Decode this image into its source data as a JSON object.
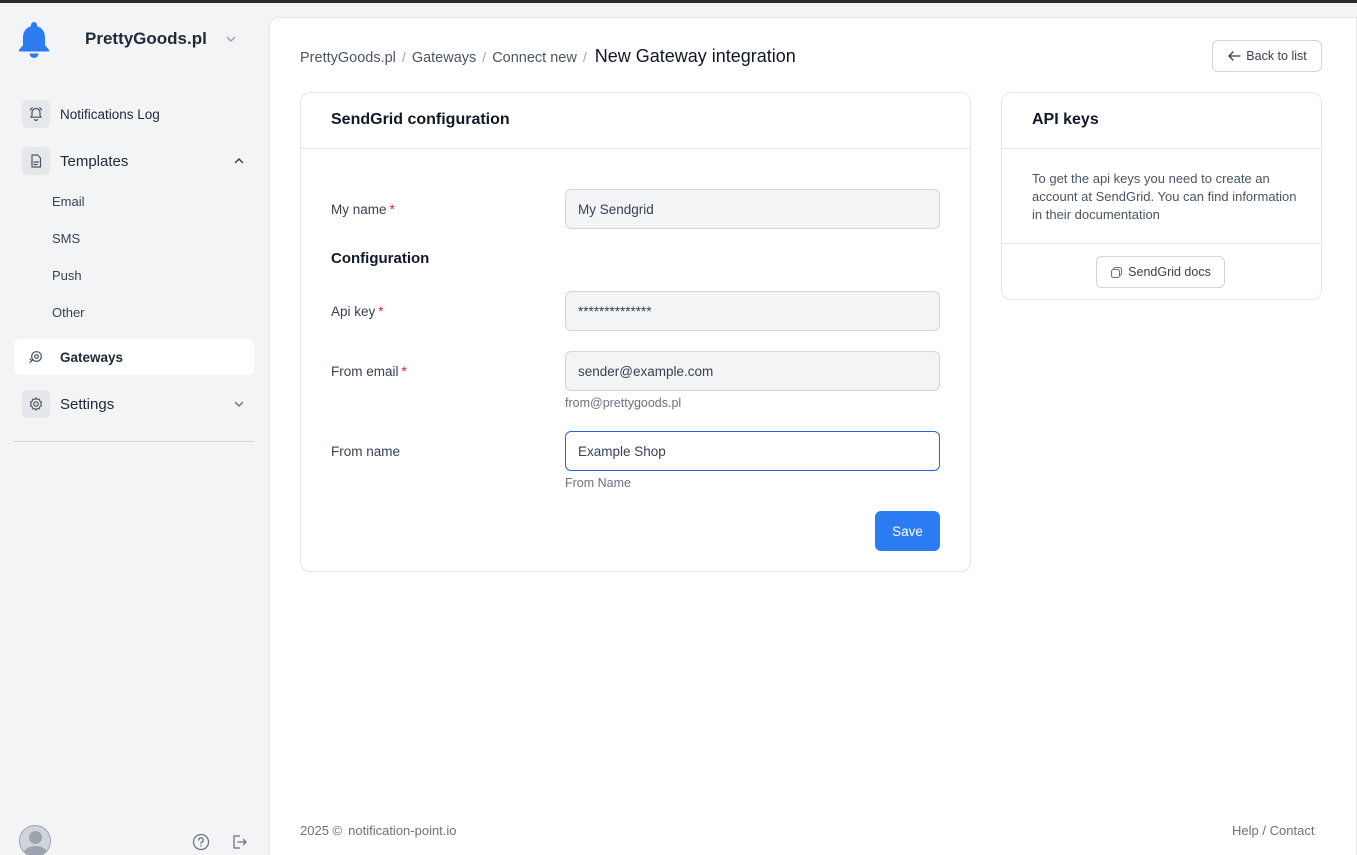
{
  "brand": {
    "name": "PrettyGoods.pl",
    "icon": "bell-icon",
    "accent": "#2b7bf3"
  },
  "sidebar": {
    "notifications_log": "Notifications Log",
    "templates": "Templates",
    "template_items": [
      "Email",
      "SMS",
      "Push",
      "Other"
    ],
    "gateways": "Gateways",
    "settings": "Settings"
  },
  "breadcrumb": {
    "items": [
      "PrettyGoods.pl",
      "Gateways",
      "Connect new"
    ],
    "separator": "/",
    "current": "New Gateway integration"
  },
  "back_button": "Back to list",
  "config_card": {
    "title": "SendGrid configuration",
    "fields": {
      "my_name": {
        "label": "My name",
        "required": "*",
        "value": "My Sendgrid"
      },
      "api_key": {
        "label": "Api key",
        "required": "*",
        "value": "**************"
      },
      "from_email": {
        "label": "From email",
        "required": "*",
        "value": "sender@example.com",
        "hint": "from@prettygoods.pl"
      },
      "from_name": {
        "label": "From name",
        "value": "Example Shop",
        "hint": "From Name"
      }
    },
    "section_title": "Configuration",
    "save_label": "Save"
  },
  "api_card": {
    "title": "API keys",
    "text": "To get the api keys you need to create an account at SendGrid. You can find information in their documentation",
    "docs_button": "SendGrid docs"
  },
  "footer": {
    "year": "2025 ©",
    "brand": "notification-point.io",
    "help": "Help",
    "separator": "/",
    "contact": "Contact"
  }
}
